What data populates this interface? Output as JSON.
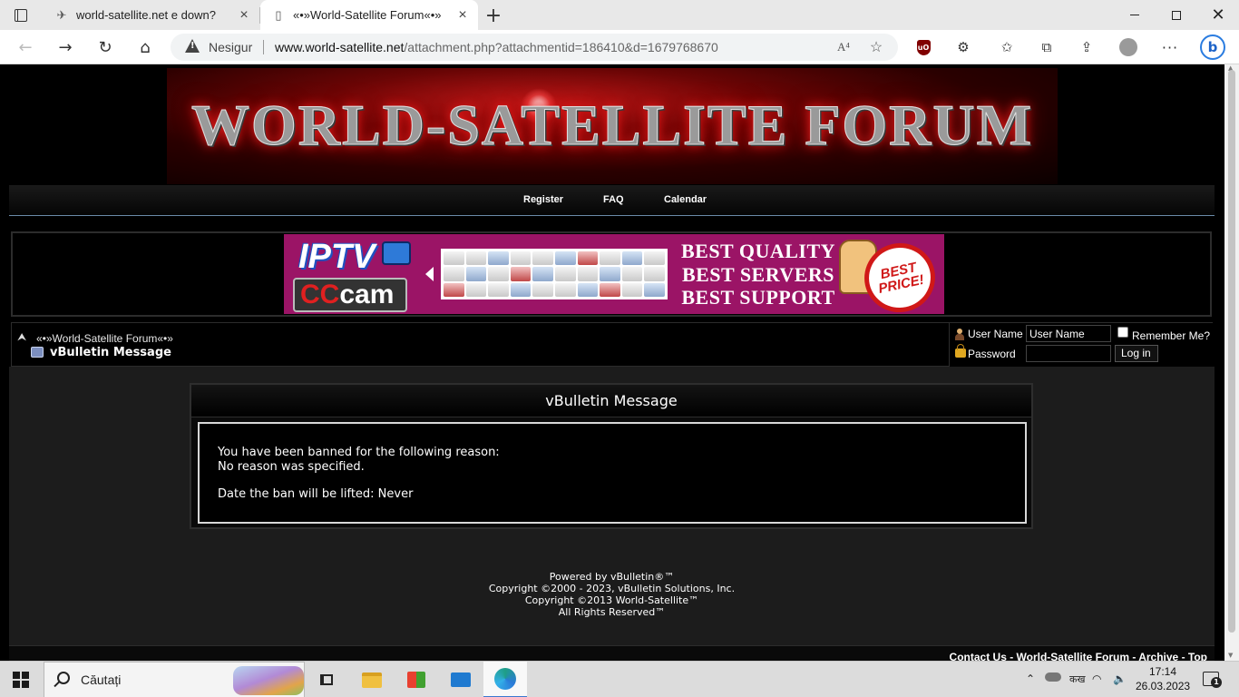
{
  "browser": {
    "tabs": [
      {
        "title": "world-satellite.net e down?",
        "icon": "satellite-icon"
      },
      {
        "title": "«•»World-Satellite Forum«•»",
        "icon": "page-icon"
      }
    ],
    "security_label": "Nesigur",
    "url_host": "www.world-satellite.net",
    "url_path": "/attachment.php?attachmentid=186410&d=1679768670",
    "read_aloud_label": "A⁴",
    "ublock_label": "uO",
    "bing_label": "b"
  },
  "site": {
    "banner_title": "WORLD-SATELLITE FORUM",
    "nav": {
      "register": "Register",
      "faq": "FAQ",
      "calendar": "Calendar"
    },
    "ad": {
      "iptv": "IPTV",
      "cccam_cc": "CC",
      "cccam_rest": "cam",
      "line1": "BEST QUALITY",
      "line2": "BEST SERVERS",
      "line3": "BEST SUPPORT",
      "seal": "BEST PRICE!"
    },
    "breadcrumb": {
      "parent": "«•»World-Satellite Forum«•»",
      "current": "vBulletin Message"
    },
    "login": {
      "user_label": "User Name",
      "user_value": "User Name",
      "remember_label": "Remember Me?",
      "password_label": "Password",
      "button": "Log in"
    },
    "message": {
      "title": "vBulletin Message",
      "line1": "You have been banned for the following reason:",
      "line2": "No reason was specified.",
      "line3": "Date the ban will be lifted: Never"
    },
    "footer": {
      "powered": "Powered by vBulletin®™",
      "copyright1": "Copyright ©2000 - 2023, vBulletin Solutions, Inc.",
      "copyright2": "Copyright ©2013 World-Satellite™",
      "rights": "All Rights Reserved™",
      "links": "Contact Us - World-Satellite Forum - Archive - Top"
    }
  },
  "taskbar": {
    "search_placeholder": "Căutați",
    "time": "17:14",
    "date": "26.03.2023",
    "notification_count": "1",
    "language_label": "कख"
  },
  "colors": {
    "page_bg": "#000000",
    "ad_bg": "#9b1466",
    "banner_red": "#c01818",
    "nav_border": "#6a8aa8"
  }
}
